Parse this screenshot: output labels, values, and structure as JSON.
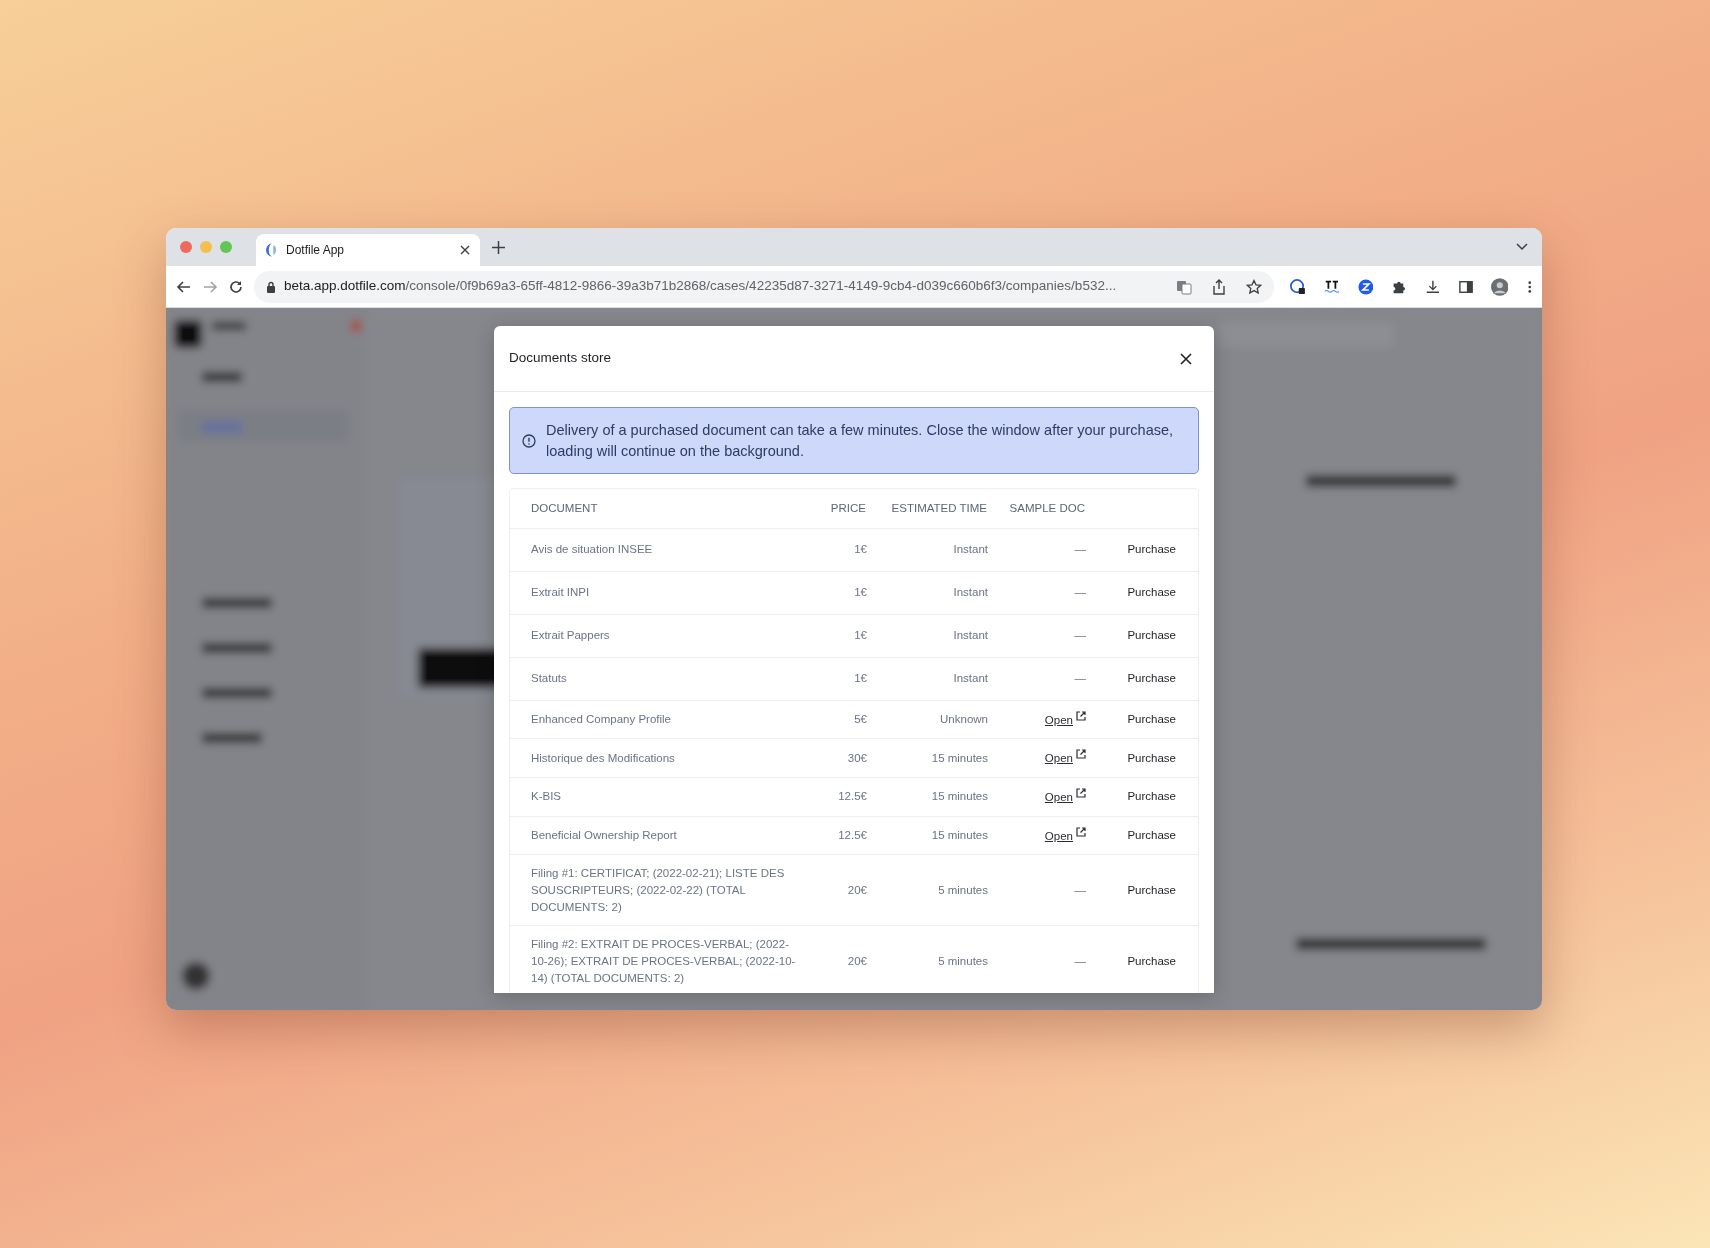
{
  "browser": {
    "tab_title": "Dotfile App",
    "url_host": "beta.app.dotfile.com",
    "url_path": "/console/0f9b69a3-65ff-4812-9866-39a3b71b2868/cases/42235d87-3271-4149-9cb4-d039c660b6f3/companies/b532..."
  },
  "modal": {
    "title": "Documents store",
    "alert": "Delivery of a purchased document can take a few minutes. Close the window after your purchase, loading will continue on the background.",
    "table": {
      "columns": [
        "DOCUMENT",
        "PRICE",
        "ESTIMATED TIME",
        "SAMPLE DOC"
      ],
      "rows": [
        {
          "document": "Avis de situation INSEE",
          "price": "1€",
          "time": "Instant",
          "sample": {
            "kind": "dash",
            "text": "—"
          },
          "action": "Purchase"
        },
        {
          "document": "Extrait INPI",
          "price": "1€",
          "time": "Instant",
          "sample": {
            "kind": "dash",
            "text": "—"
          },
          "action": "Purchase"
        },
        {
          "document": "Extrait Pappers",
          "price": "1€",
          "time": "Instant",
          "sample": {
            "kind": "dash",
            "text": "—"
          },
          "action": "Purchase"
        },
        {
          "document": "Statuts",
          "price": "1€",
          "time": "Instant",
          "sample": {
            "kind": "dash",
            "text": "—"
          },
          "action": "Purchase"
        },
        {
          "document": "Enhanced Company Profile",
          "price": "5€",
          "time": "Unknown",
          "sample": {
            "kind": "link",
            "text": "Open"
          },
          "action": "Purchase"
        },
        {
          "document": "Historique des Modifications",
          "price": "30€",
          "time": "15 minutes",
          "sample": {
            "kind": "link",
            "text": "Open"
          },
          "action": "Purchase"
        },
        {
          "document": "K-BIS",
          "price": "12.5€",
          "time": "15 minutes",
          "sample": {
            "kind": "link",
            "text": "Open"
          },
          "action": "Purchase"
        },
        {
          "document": "Beneficial Ownership Report",
          "price": "12.5€",
          "time": "15 minutes",
          "sample": {
            "kind": "link",
            "text": "Open"
          },
          "action": "Purchase"
        },
        {
          "document": "Filing #1: CERTIFICAT; (2022-02-21); LISTE DES SOUSCRIPTEURS; (2022-02-22) (TOTAL DOCUMENTS: 2)",
          "price": "20€",
          "time": "5 minutes",
          "sample": {
            "kind": "dash",
            "text": "—"
          },
          "action": "Purchase"
        },
        {
          "document": "Filing #2: EXTRAIT DE PROCES-VERBAL; (2022-10-26); EXTRAIT DE PROCES-VERBAL; (2022-10-14) (TOTAL DOCUMENTS: 2)",
          "price": "20€",
          "time": "5 minutes",
          "sample": {
            "kind": "dash",
            "text": "—"
          },
          "action": "Purchase"
        }
      ]
    }
  }
}
